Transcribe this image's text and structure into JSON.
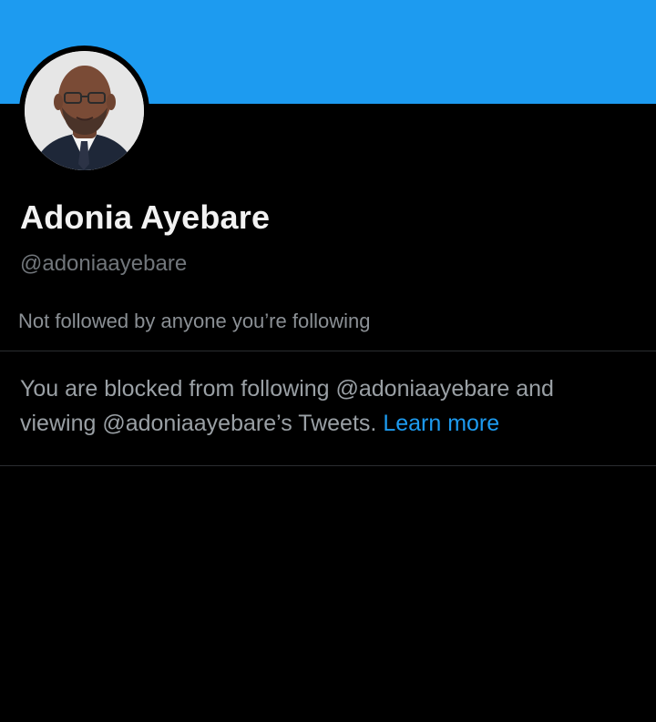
{
  "profile": {
    "display_name": "Adonia Ayebare",
    "handle": "@adoniaayebare",
    "followers_note": "Not followed by anyone you’re following"
  },
  "blocked_notice": {
    "line1": "You are blocked from following @adoniaayebare and",
    "line2": "viewing @adoniaayebare’s Tweets.",
    "learn_more": "Learn more"
  },
  "colors": {
    "banner": "#1d9bf0",
    "background": "#000000",
    "link": "#1d9bf0"
  }
}
